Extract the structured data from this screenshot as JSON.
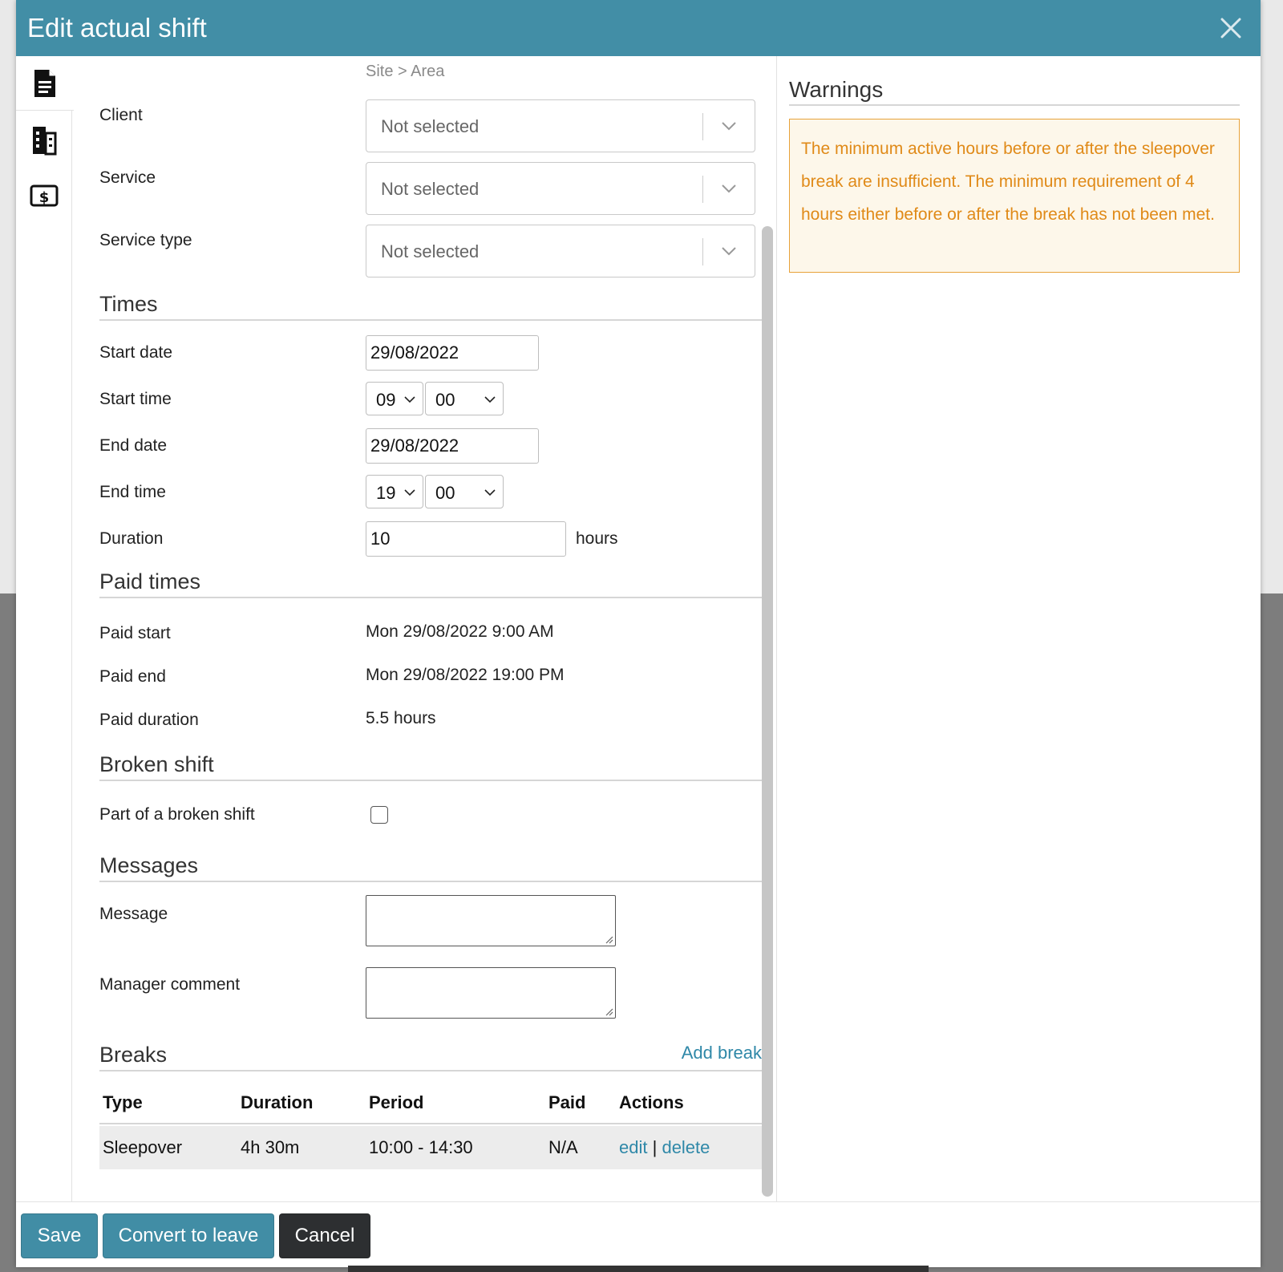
{
  "dialog": {
    "title": "Edit actual shift"
  },
  "side_tabs": [
    {
      "icon": "document-icon"
    },
    {
      "icon": "building-icon"
    },
    {
      "icon": "money-icon"
    }
  ],
  "form": {
    "breadcrumb": "Site > Area",
    "client": {
      "label": "Client",
      "value": "Not selected"
    },
    "service": {
      "label": "Service",
      "value": "Not selected"
    },
    "service_type": {
      "label": "Service type",
      "value": "Not selected"
    }
  },
  "times": {
    "heading": "Times",
    "start_date": {
      "label": "Start date",
      "value": "29/08/2022"
    },
    "start_time": {
      "label": "Start time",
      "hour": "09",
      "minute": "00"
    },
    "end_date": {
      "label": "End date",
      "value": "29/08/2022"
    },
    "end_time": {
      "label": "End time",
      "hour": "19",
      "minute": "00"
    },
    "duration": {
      "label": "Duration",
      "value": "10",
      "unit": "hours"
    }
  },
  "paid_times": {
    "heading": "Paid times",
    "paid_start": {
      "label": "Paid start",
      "value": "Mon 29/08/2022 9:00 AM"
    },
    "paid_end": {
      "label": "Paid end",
      "value": "Mon 29/08/2022 19:00 PM"
    },
    "paid_duration": {
      "label": "Paid duration",
      "value": "5.5 hours"
    }
  },
  "broken_shift": {
    "heading": "Broken shift",
    "part_of": {
      "label": "Part of a broken shift",
      "checked": false
    }
  },
  "messages": {
    "heading": "Messages",
    "message": {
      "label": "Message",
      "value": ""
    },
    "manager_comment": {
      "label": "Manager comment",
      "value": ""
    }
  },
  "breaks": {
    "heading": "Breaks",
    "add_label": "Add break",
    "columns": [
      "Type",
      "Duration",
      "Period",
      "Paid",
      "Actions"
    ],
    "rows": [
      {
        "type": "Sleepover",
        "duration": "4h 30m",
        "period": "10:00 - 14:30",
        "paid": "N/A",
        "edit": "edit",
        "sep": "|",
        "delete": "delete"
      }
    ]
  },
  "warnings": {
    "heading": "Warnings",
    "message": "The minimum active hours before or after the sleepover break are insufficient. The minimum requirement of 4 hours either before or after the break has not been met."
  },
  "footer": {
    "save": "Save",
    "convert": "Convert to leave",
    "cancel": "Cancel"
  },
  "colors": {
    "header": "#428ea6",
    "primary_button": "#418da5",
    "dark_button": "#2d2f31",
    "warning_text": "#e08a18",
    "warning_bg": "#fdf7ea",
    "link": "#2f88a8"
  }
}
